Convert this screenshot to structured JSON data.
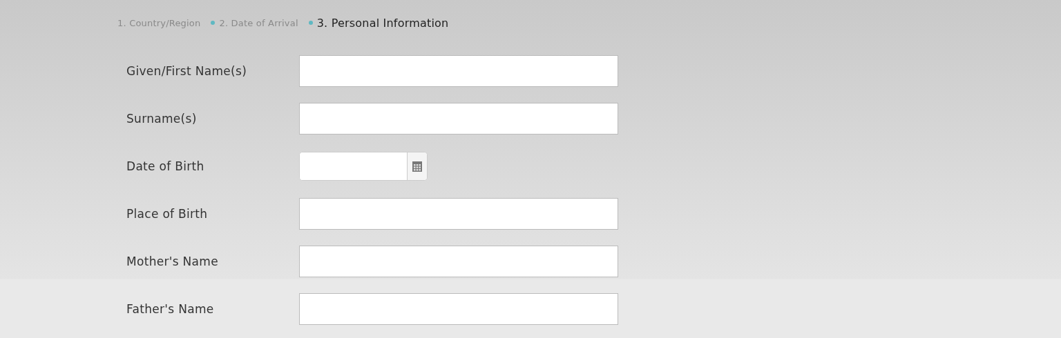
{
  "steps": [
    {
      "label": "1. Country/Region",
      "selected": false
    },
    {
      "label": "2. Date of Arrival",
      "selected": false
    },
    {
      "label": "3. Personal Information",
      "selected": true
    }
  ],
  "fields": [
    {
      "label": "Given/First Name(s)",
      "kind": "text"
    },
    {
      "label": "Surname(s)",
      "kind": "text"
    },
    {
      "label": "Date of Birth",
      "kind": "date"
    },
    {
      "label": "Place of Birth",
      "kind": "text"
    },
    {
      "label": "Mother's Name",
      "kind": "text"
    },
    {
      "label": "Father's Name",
      "kind": "text"
    }
  ]
}
